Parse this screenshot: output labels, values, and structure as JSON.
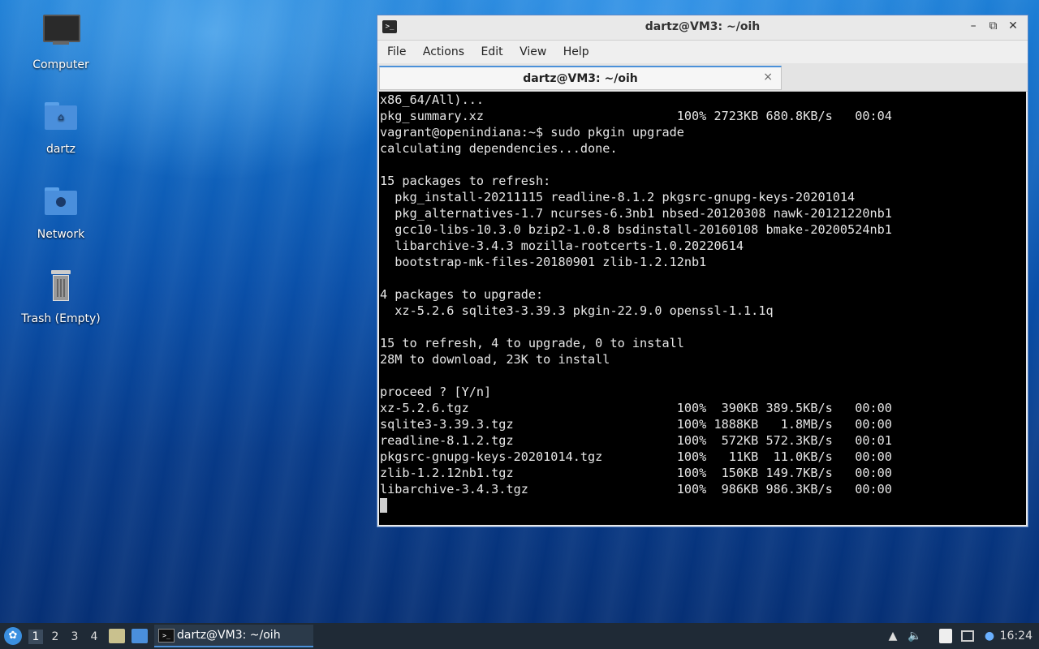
{
  "desktop": {
    "icons": [
      {
        "label": "Computer"
      },
      {
        "label": "dartz"
      },
      {
        "label": "Network"
      },
      {
        "label": "Trash (Empty)"
      }
    ]
  },
  "window": {
    "title": "dartz@VM3: ~/oih",
    "controls": {
      "minimize": "–",
      "maximize": "⧉",
      "close": "✕"
    },
    "menu": [
      "File",
      "Actions",
      "Edit",
      "View",
      "Help"
    ],
    "tab": {
      "label": "dartz@VM3: ~/oih",
      "close": "×"
    },
    "terminal_lines": [
      "x86_64/All)...",
      "pkg_summary.xz                          100% 2723KB 680.8KB/s   00:04",
      "vagrant@openindiana:~$ sudo pkgin upgrade",
      "calculating dependencies...done.",
      "",
      "15 packages to refresh:",
      "  pkg_install-20211115 readline-8.1.2 pkgsrc-gnupg-keys-20201014",
      "  pkg_alternatives-1.7 ncurses-6.3nb1 nbsed-20120308 nawk-20121220nb1",
      "  gcc10-libs-10.3.0 bzip2-1.0.8 bsdinstall-20160108 bmake-20200524nb1",
      "  libarchive-3.4.3 mozilla-rootcerts-1.0.20220614",
      "  bootstrap-mk-files-20180901 zlib-1.2.12nb1",
      "",
      "4 packages to upgrade:",
      "  xz-5.2.6 sqlite3-3.39.3 pkgin-22.9.0 openssl-1.1.1q",
      "",
      "15 to refresh, 4 to upgrade, 0 to install",
      "28M to download, 23K to install",
      "",
      "proceed ? [Y/n]",
      "xz-5.2.6.tgz                            100%  390KB 389.5KB/s   00:00",
      "sqlite3-3.39.3.tgz                      100% 1888KB   1.8MB/s   00:00",
      "readline-8.1.2.tgz                      100%  572KB 572.3KB/s   00:01",
      "pkgsrc-gnupg-keys-20201014.tgz          100%   11KB  11.0KB/s   00:00",
      "zlib-1.2.12nb1.tgz                      100%  150KB 149.7KB/s   00:00",
      "libarchive-3.4.3.tgz                    100%  986KB 986.3KB/s   00:00"
    ]
  },
  "taskbar": {
    "workspaces": [
      "1",
      "2",
      "3",
      "4"
    ],
    "active_task": "dartz@VM3: ~/oih",
    "clock": "16:24"
  }
}
